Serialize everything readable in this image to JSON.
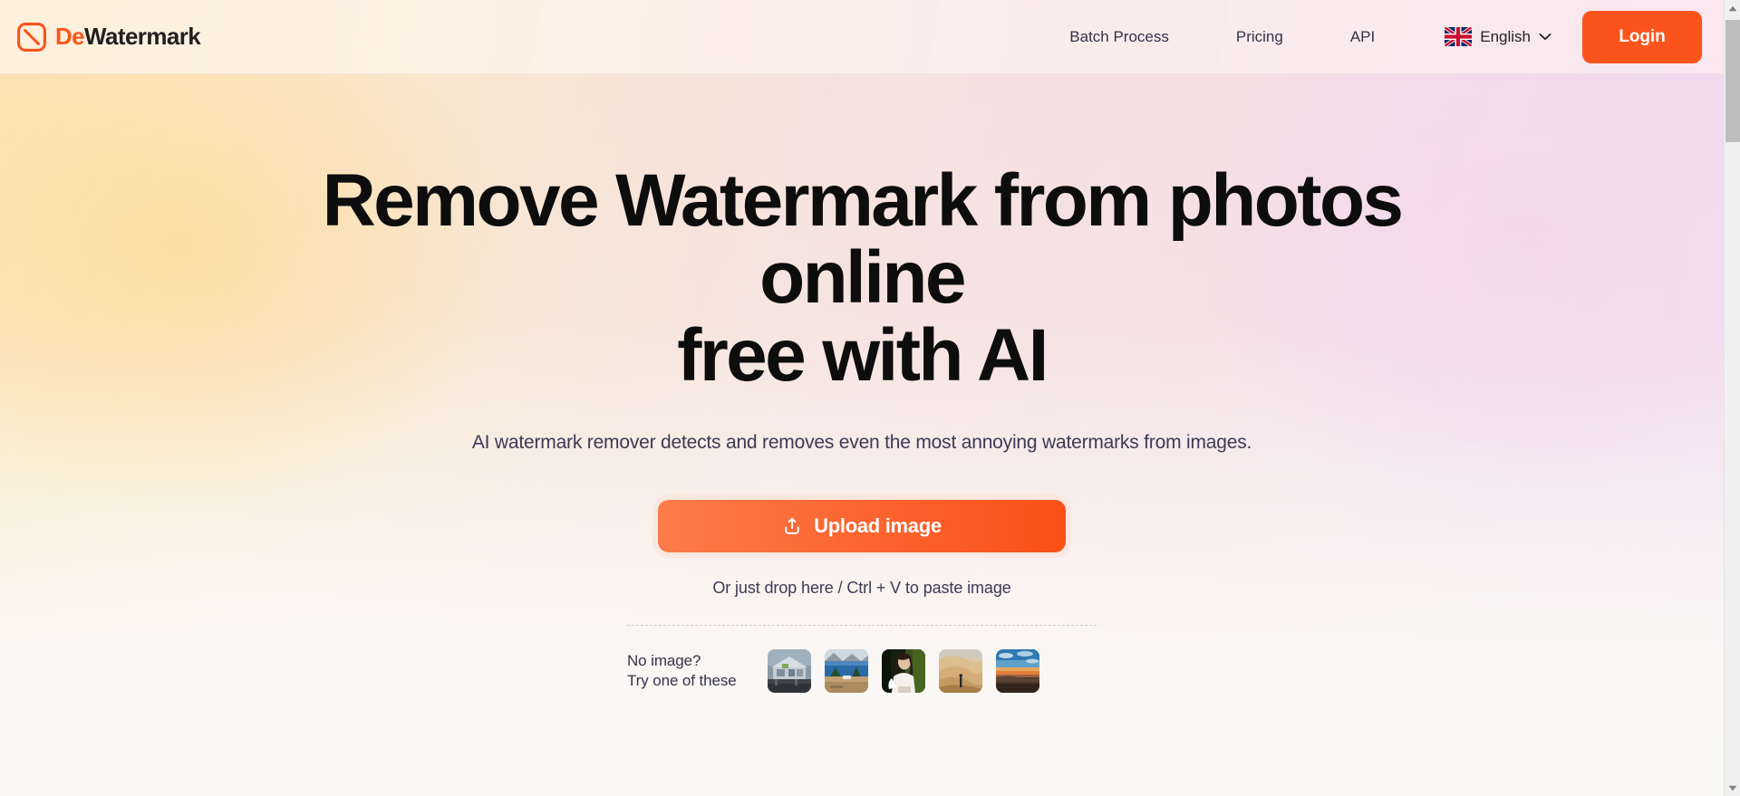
{
  "header": {
    "brand": {
      "de": "De",
      "watermark": "Watermark",
      "icon": "watermark-logo-icon"
    },
    "nav": [
      {
        "label": "Batch Process",
        "name": "nav-link-batch-process"
      },
      {
        "label": "Pricing",
        "name": "nav-link-pricing"
      },
      {
        "label": "API",
        "name": "nav-link-api"
      }
    ],
    "language": {
      "label": "English",
      "flag": "uk-flag-icon",
      "chevron": "chevron-down-icon"
    },
    "login_label": "Login"
  },
  "hero": {
    "headline_line1": "Remove Watermark from photos online",
    "headline_line2": "free with AI",
    "subtitle": "AI watermark remover detects and removes even the most annoying watermarks from images.",
    "upload_label": "Upload image",
    "upload_icon": "upload-icon",
    "drop_hint": "Or just drop here / Ctrl + V to paste image",
    "samples_label_line1": "No image?",
    "samples_label_line2": "Try one of these",
    "samples": [
      {
        "alt": "modern-house-thumbnail"
      },
      {
        "alt": "lake-mountain-thumbnail"
      },
      {
        "alt": "woman-portrait-thumbnail"
      },
      {
        "alt": "desert-dune-thumbnail"
      },
      {
        "alt": "sunset-landscape-thumbnail"
      }
    ]
  },
  "scrollbar": {
    "up": "scroll-up-arrow-icon",
    "down": "scroll-down-arrow-icon"
  },
  "colors": {
    "brand_orange": "#fa541c",
    "upload_gradient_from": "#fc7c4a",
    "upload_gradient_to": "#fa5016",
    "heading": "#0d0d0d",
    "body_text": "#3c3a55"
  }
}
